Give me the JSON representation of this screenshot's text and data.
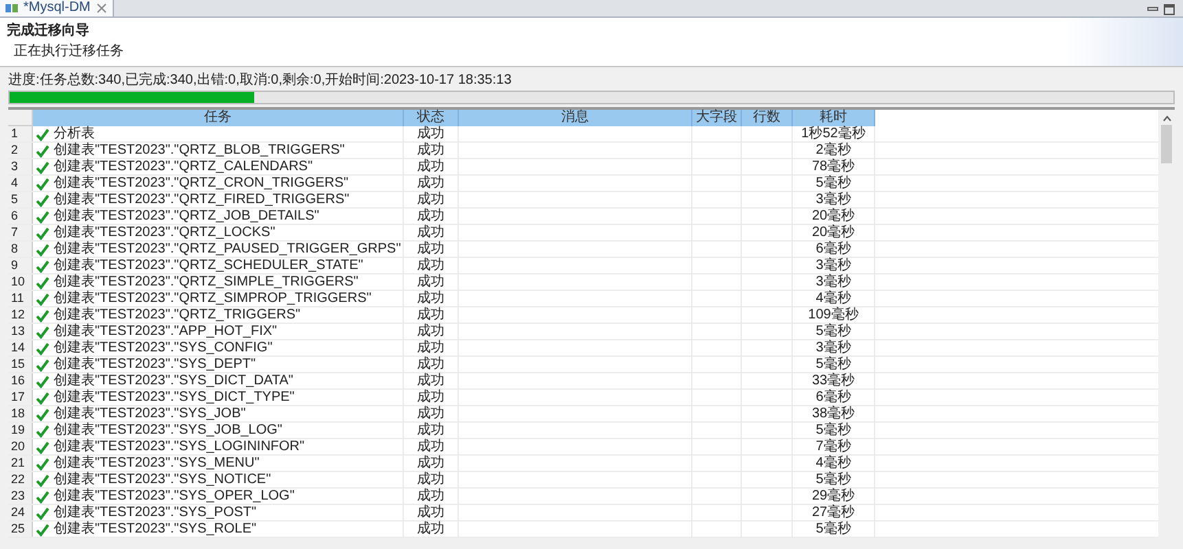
{
  "tab": {
    "title": "*Mysql-DM"
  },
  "wizard": {
    "title": "完成迁移向导",
    "subtitle": "正在执行迁移任务"
  },
  "progress": {
    "text": "进度:任务总数:340,已完成:340,出错:0,取消:0,剩余:0,开始时间:2023-10-17 18:35:13",
    "level": 0.21
  },
  "table": {
    "columns": [
      "任务",
      "状态",
      "消息",
      "大字段",
      "行数",
      "耗时"
    ],
    "rows": [
      {
        "number": "1",
        "done": true,
        "task": "分析表",
        "status": "成功",
        "duration": "1秒52毫秒"
      },
      {
        "number": "2",
        "done": true,
        "task": "创建表\"TEST2023\".\"QRTZ_BLOB_TRIGGERS\"",
        "status": "成功",
        "duration": "2毫秒"
      },
      {
        "number": "3",
        "done": true,
        "task": "创建表\"TEST2023\".\"QRTZ_CALENDARS\"",
        "status": "成功",
        "duration": "78毫秒"
      },
      {
        "number": "4",
        "done": true,
        "task": "创建表\"TEST2023\".\"QRTZ_CRON_TRIGGERS\"",
        "status": "成功",
        "duration": "5毫秒"
      },
      {
        "number": "5",
        "done": true,
        "task": "创建表\"TEST2023\".\"QRTZ_FIRED_TRIGGERS\"",
        "status": "成功",
        "duration": "3毫秒"
      },
      {
        "number": "6",
        "done": true,
        "task": "创建表\"TEST2023\".\"QRTZ_JOB_DETAILS\"",
        "status": "成功",
        "duration": "20毫秒"
      },
      {
        "number": "7",
        "done": true,
        "task": "创建表\"TEST2023\".\"QRTZ_LOCKS\"",
        "status": "成功",
        "duration": "20毫秒"
      },
      {
        "number": "8",
        "done": true,
        "task": "创建表\"TEST2023\".\"QRTZ_PAUSED_TRIGGER_GRPS\"",
        "status": "成功",
        "duration": "6毫秒"
      },
      {
        "number": "9",
        "done": true,
        "task": "创建表\"TEST2023\".\"QRTZ_SCHEDULER_STATE\"",
        "status": "成功",
        "duration": "3毫秒"
      },
      {
        "number": "10",
        "done": true,
        "task": "创建表\"TEST2023\".\"QRTZ_SIMPLE_TRIGGERS\"",
        "status": "成功",
        "duration": "3毫秒"
      },
      {
        "number": "11",
        "done": true,
        "task": "创建表\"TEST2023\".\"QRTZ_SIMPROP_TRIGGERS\"",
        "status": "成功",
        "duration": "4毫秒"
      },
      {
        "number": "12",
        "done": true,
        "task": "创建表\"TEST2023\".\"QRTZ_TRIGGERS\"",
        "status": "成功",
        "duration": "109毫秒"
      },
      {
        "number": "13",
        "done": true,
        "task": "创建表\"TEST2023\".\"APP_HOT_FIX\"",
        "status": "成功",
        "duration": "5毫秒"
      },
      {
        "number": "14",
        "done": true,
        "task": "创建表\"TEST2023\".\"SYS_CONFIG\"",
        "status": "成功",
        "duration": "3毫秒"
      },
      {
        "number": "15",
        "done": true,
        "task": "创建表\"TEST2023\".\"SYS_DEPT\"",
        "status": "成功",
        "duration": "5毫秒"
      },
      {
        "number": "16",
        "done": true,
        "task": "创建表\"TEST2023\".\"SYS_DICT_DATA\"",
        "status": "成功",
        "duration": "33毫秒"
      },
      {
        "number": "17",
        "done": true,
        "task": "创建表\"TEST2023\".\"SYS_DICT_TYPE\"",
        "status": "成功",
        "duration": "6毫秒"
      },
      {
        "number": "18",
        "done": true,
        "task": "创建表\"TEST2023\".\"SYS_JOB\"",
        "status": "成功",
        "duration": "38毫秒"
      },
      {
        "number": "19",
        "done": true,
        "task": "创建表\"TEST2023\".\"SYS_JOB_LOG\"",
        "status": "成功",
        "duration": "5毫秒"
      },
      {
        "number": "20",
        "done": true,
        "task": "创建表\"TEST2023\".\"SYS_LOGININFOR\"",
        "status": "成功",
        "duration": "7毫秒"
      },
      {
        "number": "21",
        "done": true,
        "task": "创建表\"TEST2023\".\"SYS_MENU\"",
        "status": "成功",
        "duration": "4毫秒"
      },
      {
        "number": "22",
        "done": true,
        "task": "创建表\"TEST2023\".\"SYS_NOTICE\"",
        "status": "成功",
        "duration": "5毫秒"
      },
      {
        "number": "23",
        "done": true,
        "task": "创建表\"TEST2023\".\"SYS_OPER_LOG\"",
        "status": "成功",
        "duration": "29毫秒"
      },
      {
        "number": "24",
        "done": true,
        "task": "创建表\"TEST2023\".\"SYS_POST\"",
        "status": "成功",
        "duration": "27毫秒"
      },
      {
        "number": "25",
        "done": true,
        "task": "创建表\"TEST2023\".\"SYS_ROLE\"",
        "status": "成功",
        "duration": "5毫秒"
      }
    ]
  }
}
